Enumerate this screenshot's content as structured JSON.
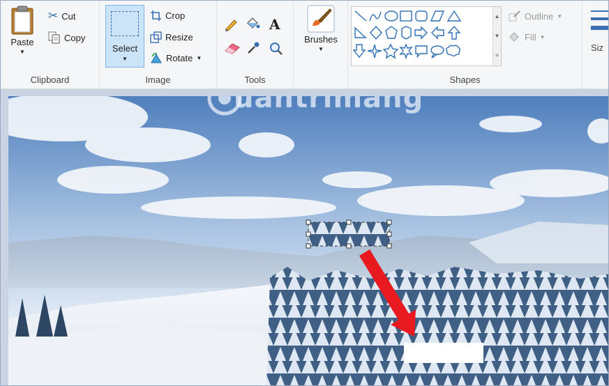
{
  "ribbon": {
    "clipboard": {
      "paste": "Paste",
      "cut": "Cut",
      "copy": "Copy",
      "label": "Clipboard"
    },
    "image": {
      "select": "Select",
      "crop": "Crop",
      "resize": "Resize",
      "rotate": "Rotate",
      "label": "Image"
    },
    "tools": {
      "label": "Tools",
      "text_tool": "A"
    },
    "brushes": {
      "label": "Brushes"
    },
    "shapes": {
      "outline": "Outline",
      "fill": "Fill",
      "label": "Shapes"
    },
    "size": {
      "label": "Siz"
    }
  },
  "watermark": {
    "text": "uantrimang"
  },
  "colors": {
    "accent_select": "#cce4f7",
    "arrow": "#e8191f",
    "ribbon_bg": "#f5f6f7"
  }
}
